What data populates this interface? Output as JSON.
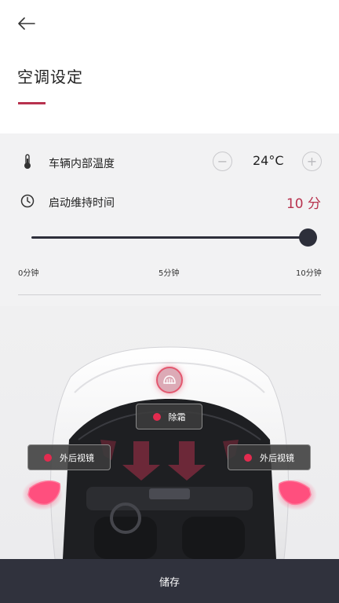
{
  "header": {
    "title": "空调设定",
    "back_icon": "arrow-left-icon",
    "accent_color": "#b8324e"
  },
  "temperature": {
    "label": "车辆内部温度",
    "value": "24°C",
    "minus_label": "−",
    "plus_label": "+",
    "icon": "thermometer-icon"
  },
  "duration": {
    "label": "启动维持时间",
    "value": "10 分",
    "icon": "clock-icon",
    "slider_fraction": 1.0,
    "ticks": [
      "0分钟",
      "5分钟",
      "10分钟"
    ]
  },
  "car": {
    "defrost_icon": "rear-defrost-icon",
    "defrost_label": "除霜",
    "mirror_left_label": "外后视镜",
    "mirror_right_label": "外后视镜",
    "active_color": "#e32b4f"
  },
  "footer": {
    "save_label": "储存"
  }
}
